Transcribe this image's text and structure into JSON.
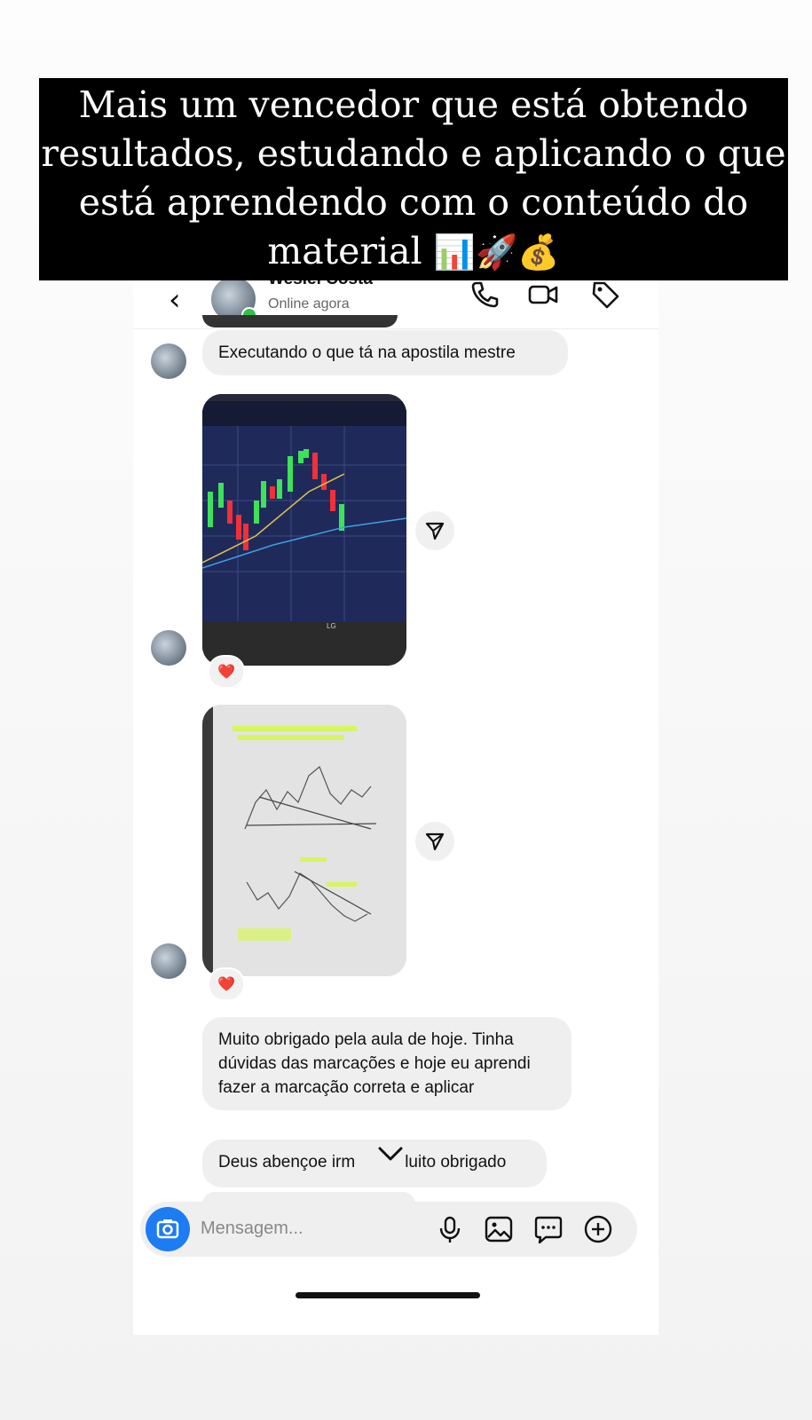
{
  "caption": {
    "text": "Mais um vencedor que está obtendo resultados, estudando e aplicando o que está aprendendo com o conteúdo do material",
    "emojis": "📊🚀💰"
  },
  "header": {
    "back_icon": "chevron-left-icon",
    "contact_name": "Wesiel Costa",
    "chevron": "›",
    "status": "Online agora",
    "actions": [
      "phone-icon",
      "video-icon",
      "tag-icon"
    ]
  },
  "messages": {
    "m1": "Executando o que tá na apostila mestre",
    "photo1": {
      "kind": "trading chart on monitor",
      "reaction": "❤️"
    },
    "photo2": {
      "kind": "notebook page with hand-drawn chart",
      "reaction": "❤️"
    },
    "m2": "Muito obrigado pela aula de hoje. Tinha dúvidas das marcações e hoje eu aprendi fazer a marcação correta e aplicar",
    "m3_left": "Deus abençoe irm",
    "m3_right": "luito obrigado"
  },
  "composer": {
    "placeholder": "Mensagem...",
    "icons": [
      "camera-icon",
      "microphone-icon",
      "image-icon",
      "sticker-icon",
      "plus-icon"
    ]
  },
  "colors": {
    "accent": "#1d7cf2",
    "online": "#2fc24d",
    "bubble": "#efefef"
  }
}
